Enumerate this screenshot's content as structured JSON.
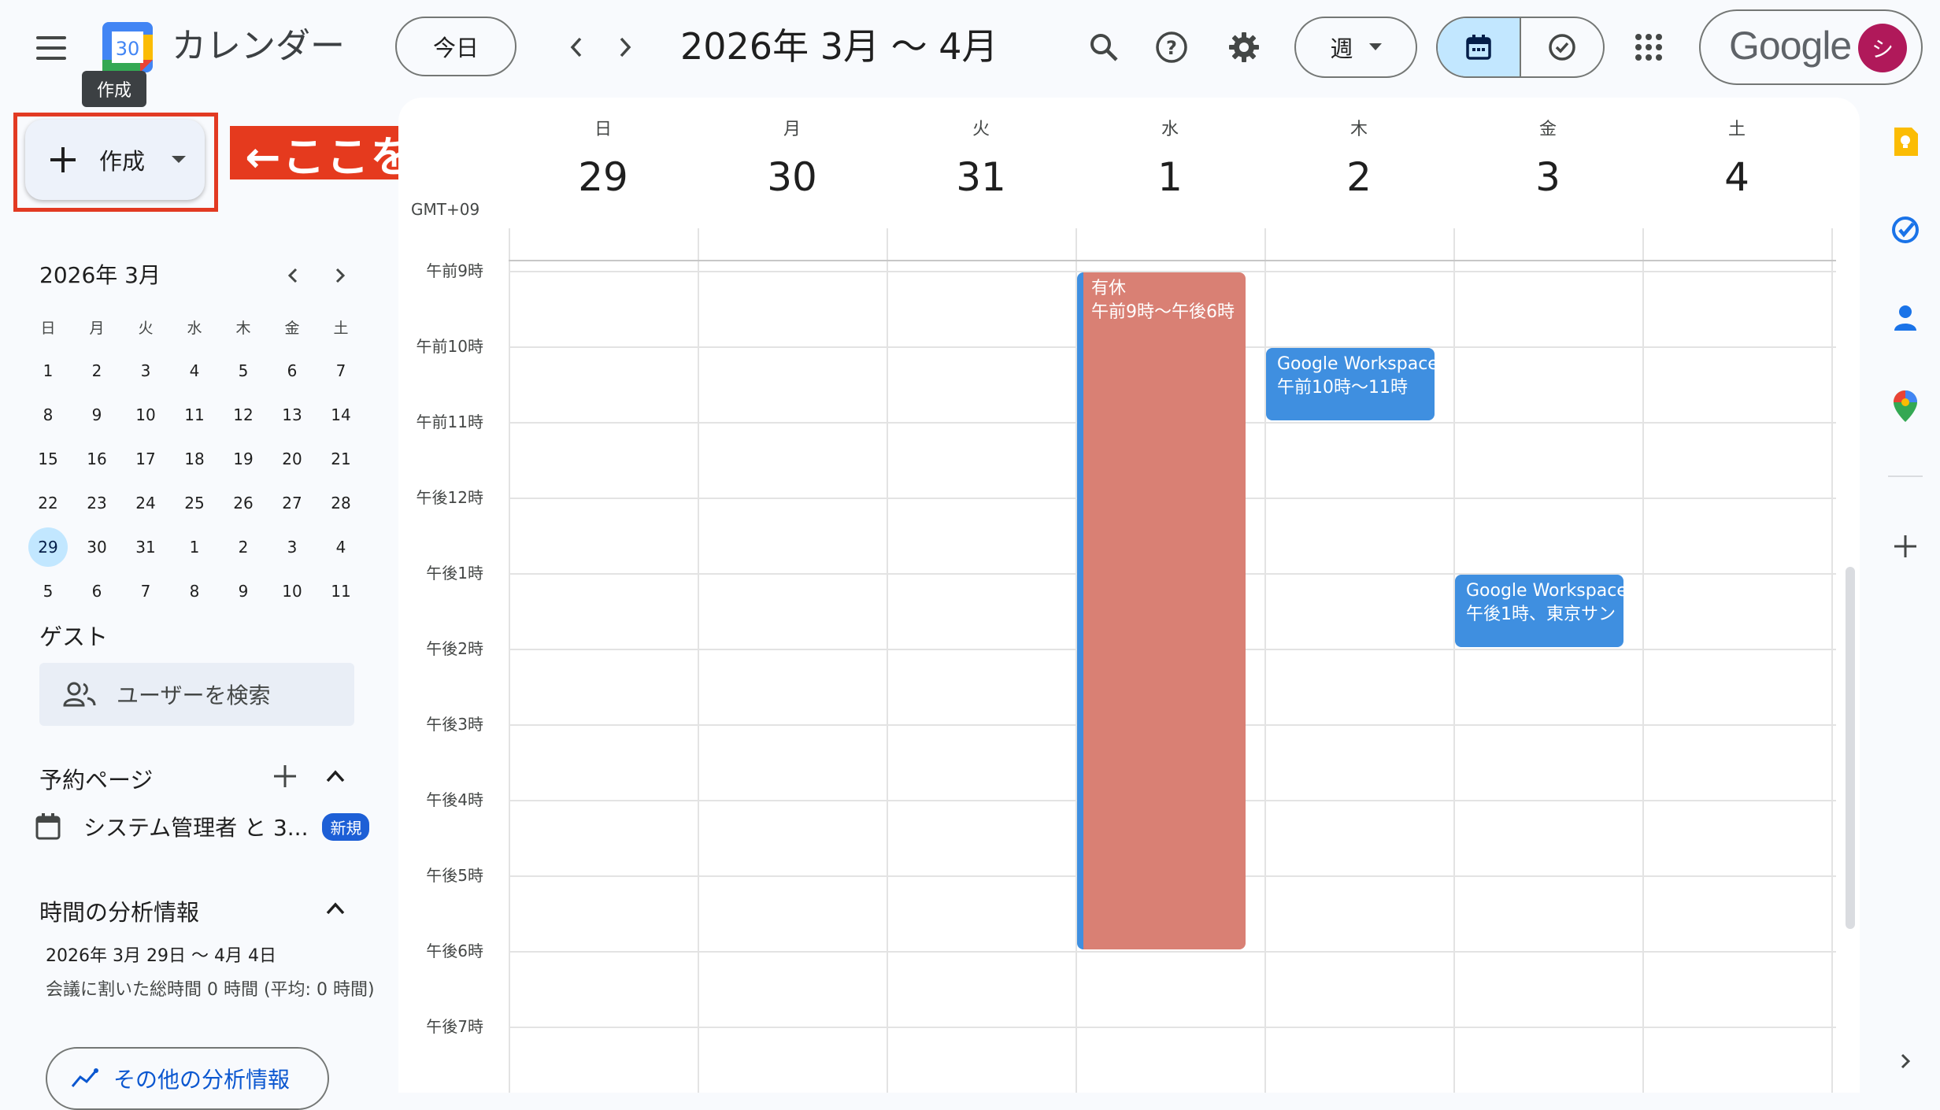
{
  "header": {
    "app_title": "カレンダー",
    "logo_day": "30",
    "today_label": "今日",
    "date_range": "2026年 3月 〜 4月",
    "view_label": "週",
    "brand": "Google",
    "avatar_initial": "シ"
  },
  "tooltip": "作成",
  "create_label": "作成",
  "annotation": "←ここをクリック",
  "mini_calendar": {
    "title": "2026年 3月",
    "weekdays": [
      "日",
      "月",
      "火",
      "水",
      "木",
      "金",
      "土"
    ],
    "weeks": [
      [
        "1",
        "2",
        "3",
        "4",
        "5",
        "6",
        "7"
      ],
      [
        "8",
        "9",
        "10",
        "11",
        "12",
        "13",
        "14"
      ],
      [
        "15",
        "16",
        "17",
        "18",
        "19",
        "20",
        "21"
      ],
      [
        "22",
        "23",
        "24",
        "25",
        "26",
        "27",
        "28"
      ],
      [
        "29",
        "30",
        "31",
        "1",
        "2",
        "3",
        "4"
      ],
      [
        "5",
        "6",
        "7",
        "8",
        "9",
        "10",
        "11"
      ]
    ],
    "selected": "29"
  },
  "guests": {
    "heading": "ゲスト",
    "search_placeholder": "ユーザーを検索"
  },
  "booking": {
    "heading": "予約ページ",
    "item_label": "システム管理者 と 3...",
    "badge": "新規"
  },
  "analytics": {
    "heading": "時間の分析情報",
    "range": "2026年 3月 29日 〜 4月 4日",
    "summary": "会議に割いた総時間 0 時間 (平均: 0 時間)",
    "more_label": "その他の分析情報"
  },
  "week": {
    "timezone": "GMT+09",
    "days": [
      {
        "name": "日",
        "num": "29"
      },
      {
        "name": "月",
        "num": "30"
      },
      {
        "name": "火",
        "num": "31"
      },
      {
        "name": "水",
        "num": "1"
      },
      {
        "name": "木",
        "num": "2"
      },
      {
        "name": "金",
        "num": "3"
      },
      {
        "name": "土",
        "num": "4"
      }
    ],
    "hours": [
      "午前9時",
      "午前10時",
      "午前11時",
      "午後12時",
      "午後1時",
      "午後2時",
      "午後3時",
      "午後4時",
      "午後5時",
      "午後6時",
      "午後7時"
    ]
  },
  "events": [
    {
      "title": "有休",
      "time": "午前9時〜午後6時",
      "color": "#d98074"
    },
    {
      "title": "Google Workspace",
      "time": "午前10時〜11時",
      "color": "#3f8fe0"
    },
    {
      "title": "Google Workspace",
      "time": "午後1時、東京サン",
      "color": "#3f8fe0"
    }
  ]
}
